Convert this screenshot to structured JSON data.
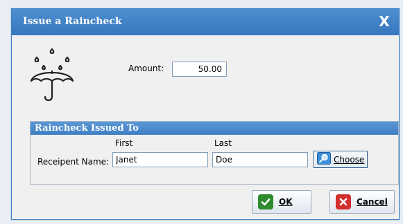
{
  "dialog": {
    "title": "Issue a Raincheck",
    "close_label": "X"
  },
  "amount": {
    "label": "Amount:",
    "value": "50.00"
  },
  "issued_to": {
    "heading": "Raincheck Issued To",
    "first_label": "First",
    "last_label": "Last",
    "recipient_label": "Receipent Name:",
    "first_value": "Janet",
    "last_value": "Doe",
    "choose_label": "Choose"
  },
  "buttons": {
    "ok_label": "OK",
    "cancel_label": "Cancel"
  },
  "colors": {
    "titlebar": "#3777be",
    "ok_icon": "#2e8b2e",
    "cancel_icon": "#d32f2f"
  },
  "icons": {
    "app": "umbrella-rain-icon",
    "choose": "search-magnifier-icon",
    "ok": "checkmark-icon",
    "cancel": "close-x-icon"
  }
}
